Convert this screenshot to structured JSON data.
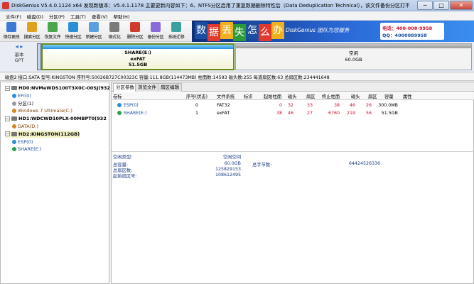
{
  "title": "DiskGenius V5.4.0.1124 x64  发现新版本：V5.4.1.1178 主要更新内容如下：6、NTFS分区启用了重复数据删除特性后（Data Deduplication Technical），该文件备份分区打不开，\"System Volume...",
  "window_buttons": {
    "minimize": "─",
    "maximize": "□",
    "close": "✕"
  },
  "menu": [
    "文件(F)",
    "磁盘(D)",
    "分区(P)",
    "工具(T)",
    "查看(V)",
    "帮助(H)"
  ],
  "toolbar": [
    {
      "label": "保存更改",
      "icon": "save-icon",
      "color": "#3a7bd5"
    },
    {
      "label": "搜索分区",
      "icon": "search-partition-icon",
      "color": "#e0a020"
    },
    {
      "label": "恢复文件",
      "icon": "recover-file-icon",
      "color": "#4aa84a"
    },
    {
      "label": "快速分区",
      "icon": "quick-partition-icon",
      "color": "#2a8fd9"
    },
    {
      "label": "新建分区",
      "icon": "new-partition-icon",
      "color": "#5aa0e0"
    },
    {
      "label": "格式化",
      "icon": "format-icon",
      "color": "#7a7a7a"
    },
    {
      "label": "删除分区",
      "icon": "delete-partition-icon",
      "color": "#d03a2f"
    },
    {
      "label": "备份分区",
      "icon": "backup-partition-icon",
      "color": "#8a6ad8"
    },
    {
      "label": "系统迁移",
      "icon": "system-migrate-icon",
      "color": "#3aa0a0"
    }
  ],
  "banner": {
    "tiles": [
      "数",
      "据",
      "丢",
      "失",
      "怎",
      "么",
      "办"
    ],
    "tile_colors": [
      "#1a4ea0",
      "#e03a2f",
      "#f0b020",
      "#2a9a3a",
      "#1a4ea0",
      "#e03a2f",
      "#f0b020"
    ],
    "slogan": "DiskGenius 团队为您服务",
    "phone1": "电话：400-008-9958",
    "phone2": "QQ：4000089958"
  },
  "disk_map": {
    "left_lines": [
      "基本",
      "GPT"
    ],
    "share": {
      "name": "SHARE(E:)",
      "fs": "exFAT",
      "size": "51.5GB"
    },
    "free": {
      "name": "空闲",
      "size": "60.0GB"
    }
  },
  "disk_info": "磁盘2 接口:SATA  型号:KINGSTON  序列号:50026B727C00323C  容量:111.8GB(114473MB)  柱面数:14593  磁头数:255  每道扇区数:63  总扇区数:234441648",
  "tree": [
    {
      "text": "HD0:NVMeWDS100T3X0C-00SJ(932",
      "level": 0,
      "type": "disk",
      "exp": "−",
      "bold": true
    },
    {
      "text": "EFI(0)",
      "level": 1,
      "type": "part",
      "color": "#1a4ea0",
      "dot": "#2a8fd9"
    },
    {
      "text": "分区(1)",
      "level": 1,
      "type": "part",
      "color": "#000000",
      "dot": "#999999"
    },
    {
      "text": "Windows 7 Ultimate(C:)",
      "level": 1,
      "type": "part",
      "color": "#7a3e00",
      "dot": "#d08a20"
    },
    {
      "text": "HD1:WDCWD10PLX-00MBPT0(932",
      "level": 0,
      "type": "disk",
      "exp": "−",
      "bold": true
    },
    {
      "text": "DATA(D:)",
      "level": 1,
      "type": "part",
      "color": "#7a3e00",
      "dot": "#d08a20"
    },
    {
      "text": "HD2:KINGSTON(112GB)",
      "level": 0,
      "type": "disk",
      "exp": "−",
      "bold": true,
      "selected": true
    },
    {
      "text": "ESP(0)",
      "level": 1,
      "type": "part",
      "color": "#1a4ea0",
      "dot": "#2a8fd9"
    },
    {
      "text": "SHARE(E:)",
      "level": 1,
      "type": "part",
      "color": "#1a4ea0",
      "dot": "#2aa04a"
    }
  ],
  "tabs": [
    "分区参数",
    "浏览文件",
    "扇区编辑"
  ],
  "columns": [
    "卷标",
    "序号(状态)",
    "文件系统",
    "标识",
    "起始柱面",
    "磁头",
    "扇区",
    "终止柱面",
    "磁头",
    "扇区",
    "容量",
    "属性"
  ],
  "rows": [
    {
      "label": "ESP(0)",
      "index": "0",
      "fs": "FAT32",
      "id": "",
      "sc": "0",
      "sh": "32",
      "ss": "33",
      "ec": "38",
      "eh": "46",
      "es": "26",
      "cap": "300.0MB",
      "attr": "",
      "dot": "#2a8fd9"
    },
    {
      "label": "SHARE(E:)",
      "index": "1",
      "fs": "exFAT",
      "id": "",
      "sc": "38",
      "sh": "46",
      "ss": "27",
      "ec": "6760",
      "eh": "219",
      "es": "56",
      "cap": "51.5GB",
      "attr": "",
      "dot": "#2aa04a"
    }
  ],
  "details": {
    "type_label": "空闲类型:",
    "type_value": "空闲空间",
    "capacity_label": "总容量:",
    "capacity_value": "60.0GB",
    "bytes_label": "总字节数:",
    "bytes_value": "64424526336",
    "sectors_label": "总扇区数:",
    "sectors_value": "125829153",
    "start_label": "起始扇区号:",
    "start_value": "108612495"
  }
}
